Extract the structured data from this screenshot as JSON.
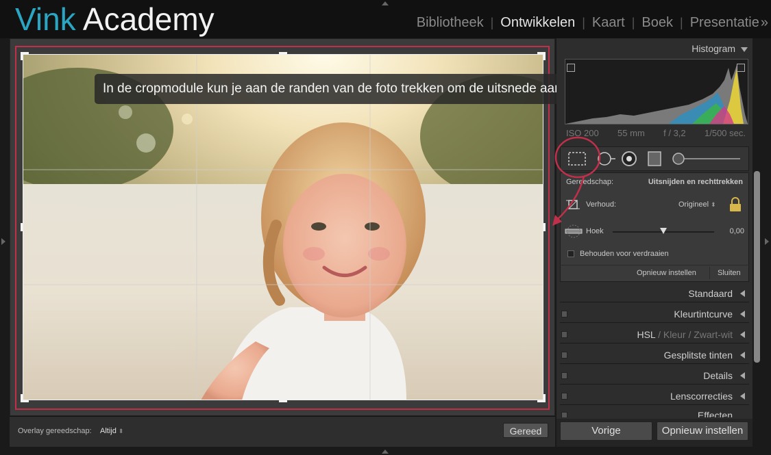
{
  "brand": {
    "part1": "Vink",
    "part2": "Academy"
  },
  "modules": [
    {
      "label": "Bibliotheek",
      "active": false
    },
    {
      "label": "Ontwikkelen",
      "active": true
    },
    {
      "label": "Kaart",
      "active": false
    },
    {
      "label": "Boek",
      "active": false
    },
    {
      "label": "Presentatie",
      "active": false
    }
  ],
  "modules_more": "»",
  "tooltip": "In de cropmodule kun je aan de randen van de foto trekken om de uitsnede aan te passen.",
  "toolbar": {
    "overlay_label": "Overlay gereedschap:",
    "overlay_value": "Altijd",
    "done_label": "Gereed"
  },
  "histogram": {
    "title": "Histogram"
  },
  "exif": {
    "iso": "ISO 200",
    "focal": "55 mm",
    "aperture": "f / 3,2",
    "shutter": "1/500 sec."
  },
  "crop": {
    "tool_label": "Gereedschap:",
    "tool_value": "Uitsnijden en rechttrekken",
    "aspect_label": "Verhoud:",
    "aspect_value": "Origineel",
    "angle_label": "Hoek",
    "angle_value": "0,00",
    "angle_slider": 0.5,
    "constrain_label": "Behouden voor verdraaien",
    "reset_label": "Opnieuw instellen",
    "close_label": "Sluiten"
  },
  "sections": [
    {
      "label": "Standaard",
      "switch": false
    },
    {
      "label": "Kleurtintcurve",
      "switch": true
    },
    {
      "label_hsl": "HSL",
      "label_kleur": "Kleur",
      "label_zw": "Zwart-wit",
      "switch": true
    },
    {
      "label": "Gesplitste tinten",
      "switch": true
    },
    {
      "label": "Details",
      "switch": true
    },
    {
      "label": "Lenscorrecties",
      "switch": true
    },
    {
      "label": "Effecten",
      "switch": true
    }
  ],
  "buttons": {
    "previous": "Vorige",
    "reset": "Opnieuw instellen"
  },
  "colors": {
    "accent_blue": "#2aa6c2",
    "highlight_red": "#c0304a"
  }
}
